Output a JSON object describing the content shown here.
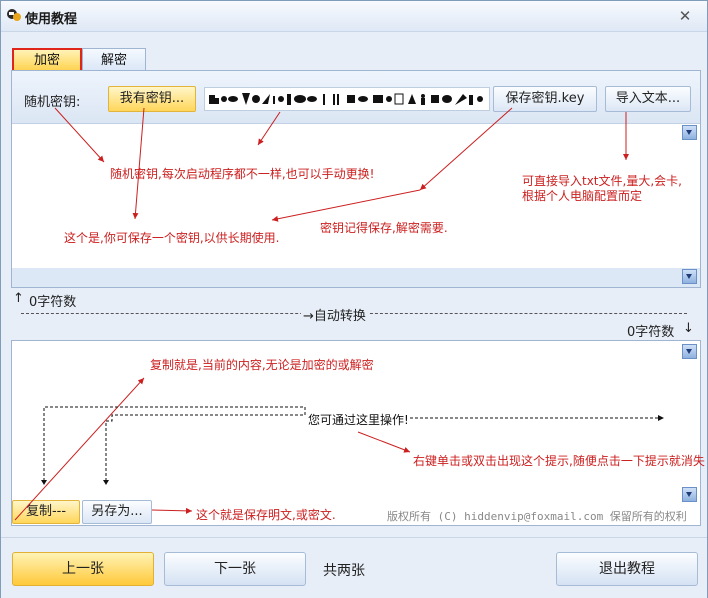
{
  "window": {
    "title": "使用教程"
  },
  "tabs": [
    {
      "label": "加密",
      "active": true
    },
    {
      "label": "解密",
      "active": false
    }
  ],
  "encrypt": {
    "random_key_label": "随机密钥:",
    "have_key_button": "我有密钥...",
    "save_key_button": "保存密钥.key",
    "import_text_button": "导入文本..."
  },
  "converter": {
    "top_count": "0字符数",
    "auto_convert": "→自动转换",
    "bottom_count": "0字符数"
  },
  "decrypt_area": {
    "hint": "您可通过这里操作!",
    "copy_button": "复制---",
    "save_as_button": "另存为...",
    "copyright": "版权所有 (C) hiddenvip@foxmail.com 保留所有的权利"
  },
  "annotations": {
    "random_key": "随机密钥,每次启动程序都不一样,也可以手动更换!",
    "import": "可直接导入txt文件,量大,会卡,",
    "import_2": "根据个人电脑配置而定",
    "save_key": "密钥记得保存,解密需要.",
    "have_key": "这个是,你可保存一个密钥,以供长期使用.",
    "copy": "复制就是,当前的内容,无论是加密的或解密",
    "right_click": "右键单击或双击出现这个提示,随便点击一下提示就消失",
    "save_as": "这个就是保存明文,或密文."
  },
  "nav": {
    "prev": "上一张",
    "next": "下一张",
    "page_info": "共两张",
    "exit": "退出教程"
  },
  "colors": {
    "annotation": "#cc1f1f",
    "active_tab_border": "#e0261b",
    "yellow_button": "#ffd24d"
  }
}
